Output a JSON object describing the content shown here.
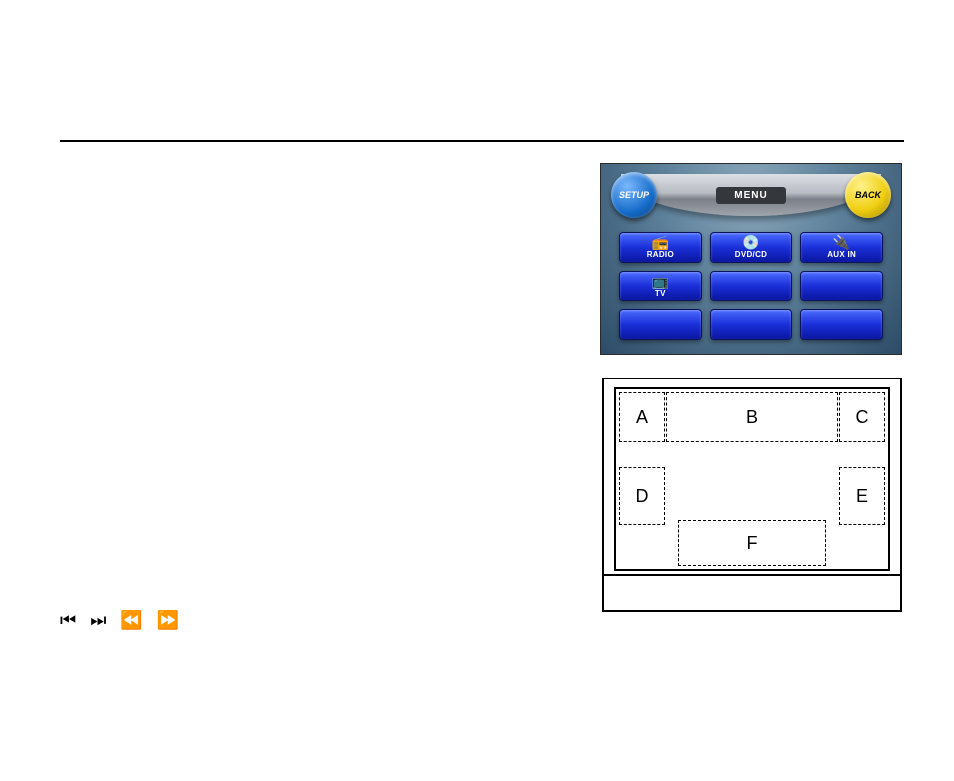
{
  "menu": {
    "banner": "MENU",
    "setup": "SETUP",
    "back": "BACK",
    "tiles": [
      "RADIO",
      "DVD/CD",
      "AUX IN",
      "TV",
      "",
      "",
      "",
      "",
      ""
    ]
  },
  "diagram": {
    "zones": {
      "A": "A",
      "B": "B",
      "C": "C",
      "D": "D",
      "E": "E",
      "F": "F"
    }
  },
  "transport_icons": [
    "⏮",
    "⏭",
    "⏪",
    "⏩"
  ]
}
